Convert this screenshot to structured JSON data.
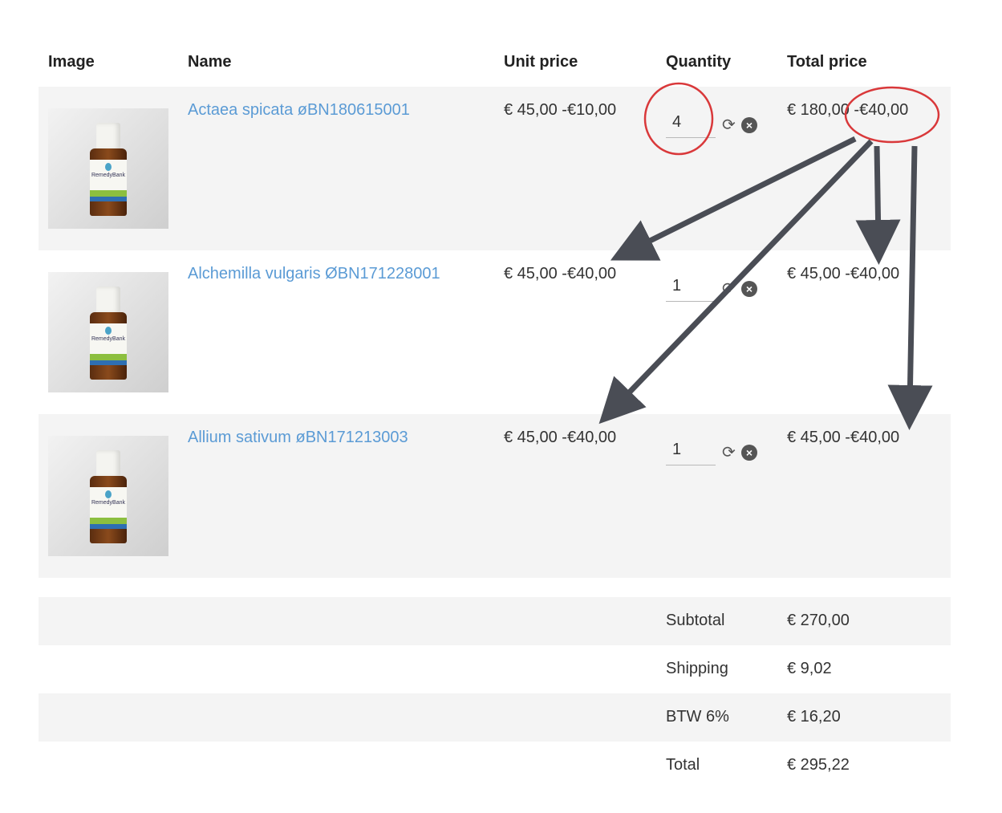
{
  "header": {
    "image": "Image",
    "name": "Name",
    "unit_price": "Unit price",
    "quantity": "Quantity",
    "total_price": "Total price"
  },
  "product_image": {
    "brand": "RemedyBank"
  },
  "items": [
    {
      "name": "Actaea spicata øBN180615001",
      "unit_price": "€ 45,00 -€10,00",
      "quantity": "4",
      "total": "€ 180,00 -€40,00"
    },
    {
      "name": "Alchemilla vulgaris ØBN171228001",
      "unit_price": "€ 45,00 -€40,00",
      "quantity": "1",
      "total": "€ 45,00 -€40,00"
    },
    {
      "name": "Allium sativum øBN171213003",
      "unit_price": "€ 45,00 -€40,00",
      "quantity": "1",
      "total": "€ 45,00 -€40,00"
    }
  ],
  "summary": [
    {
      "label": "Subtotal",
      "value": "€ 270,00"
    },
    {
      "label": "Shipping",
      "value": "€ 9,02"
    },
    {
      "label": "BTW 6%",
      "value": "€ 16,20"
    },
    {
      "label": "Total",
      "value": "€ 295,22"
    }
  ],
  "icons": {
    "refresh": "refresh-icon",
    "remove": "remove-icon"
  },
  "colors": {
    "link": "#5b9bd5",
    "row_shade": "#f4f4f4",
    "annotation_circle": "#d9383a",
    "annotation_arrow": "#4a4d55"
  }
}
